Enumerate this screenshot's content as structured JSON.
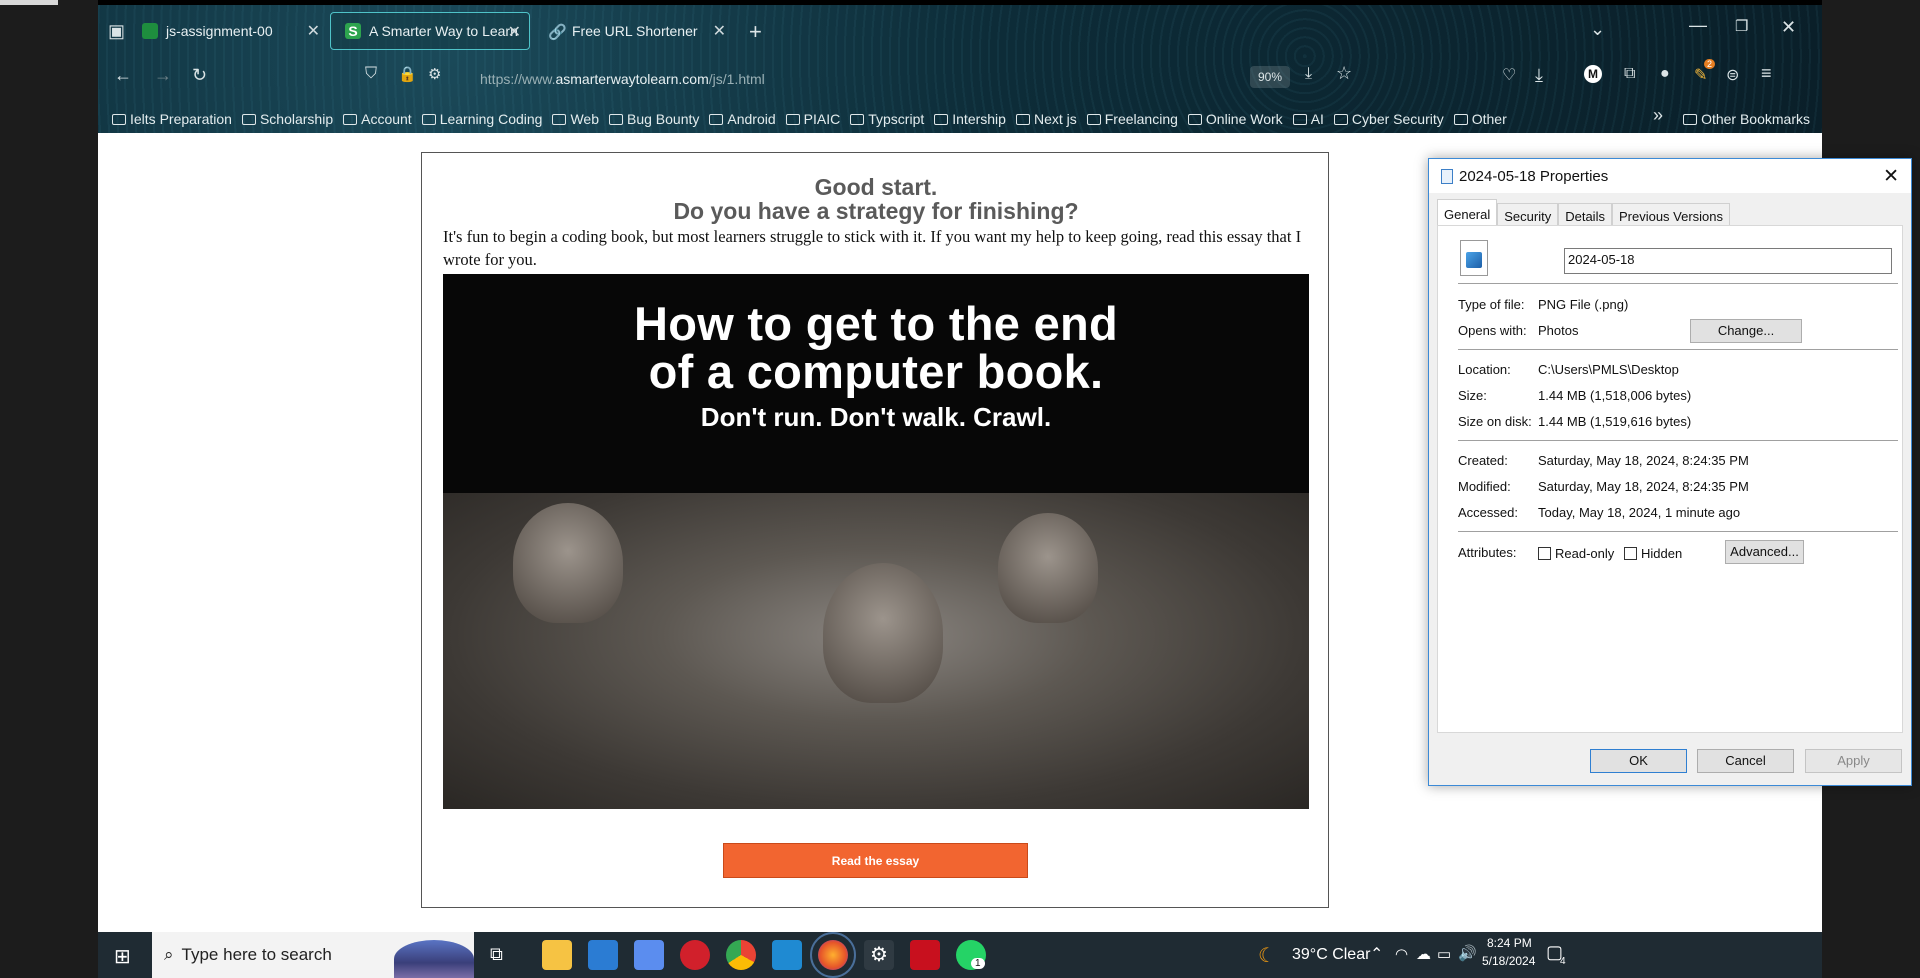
{
  "browser": {
    "tabs": [
      {
        "label": "js-assignment-00",
        "icon": "classroom-icon"
      },
      {
        "label": "A Smarter Way to Learn JavaSc",
        "icon": "s-logo-icon"
      },
      {
        "label": "Free URL Shortener",
        "icon": "link-icon"
      }
    ],
    "url_prefix": "https://www.",
    "url_domain": "asmarterwaytolearn.com",
    "url_path": "/js/1.html",
    "zoom": "90%",
    "bookmarks": [
      "Ielts Preparation",
      "Scholarship",
      "Account",
      "Learning Coding",
      "Web",
      "Bug Bounty",
      "Android",
      "PIAIC",
      "Typscript",
      "Intership",
      "Next js",
      "Freelancing",
      "Online Work",
      "AI",
      "Cyber Security",
      "Other"
    ],
    "other_bookmarks": "Other Bookmarks",
    "profile_initial": "M",
    "extension_badge": "2"
  },
  "page": {
    "heading1": "Good start.",
    "heading2": "Do you have a strategy for finishing?",
    "paragraph": "It's fun to begin a coding book, but most learners struggle to stick with it. If you want my help to keep going, read this essay that I wrote for you.",
    "hero_line1": "How to get to the end",
    "hero_line2": "of a computer book.",
    "hero_line3": "Don't run. Don't walk. Crawl.",
    "button": "Read the essay"
  },
  "dialog": {
    "title": "2024-05-18 Properties",
    "tabs": [
      "General",
      "Security",
      "Details",
      "Previous Versions"
    ],
    "filename": "2024-05-18",
    "type_label": "Type of file:",
    "type_value": "PNG File (.png)",
    "opens_label": "Opens with:",
    "opens_value": "Photos",
    "change_btn": "Change...",
    "location_label": "Location:",
    "location_value": "C:\\Users\\PMLS\\Desktop",
    "size_label": "Size:",
    "size_value": "1.44 MB (1,518,006 bytes)",
    "disk_label": "Size on disk:",
    "disk_value": "1.44 MB (1,519,616 bytes)",
    "created_label": "Created:",
    "created_value": "Saturday, May 18, 2024, 8:24:35 PM",
    "modified_label": "Modified:",
    "modified_value": "Saturday, May 18, 2024, 8:24:35 PM",
    "accessed_label": "Accessed:",
    "accessed_value": "Today, May 18, 2024, 1 minute ago",
    "attr_label": "Attributes:",
    "readonly": "Read-only",
    "hidden": "Hidden",
    "advanced_btn": "Advanced...",
    "ok": "OK",
    "cancel": "Cancel",
    "apply": "Apply"
  },
  "taskbar": {
    "search_placeholder": "Type here to search",
    "weather": "39°C  Clear",
    "time": "8:24 PM",
    "date": "5/18/2024",
    "notif_count": "4",
    "whatsapp_badge": "1"
  }
}
